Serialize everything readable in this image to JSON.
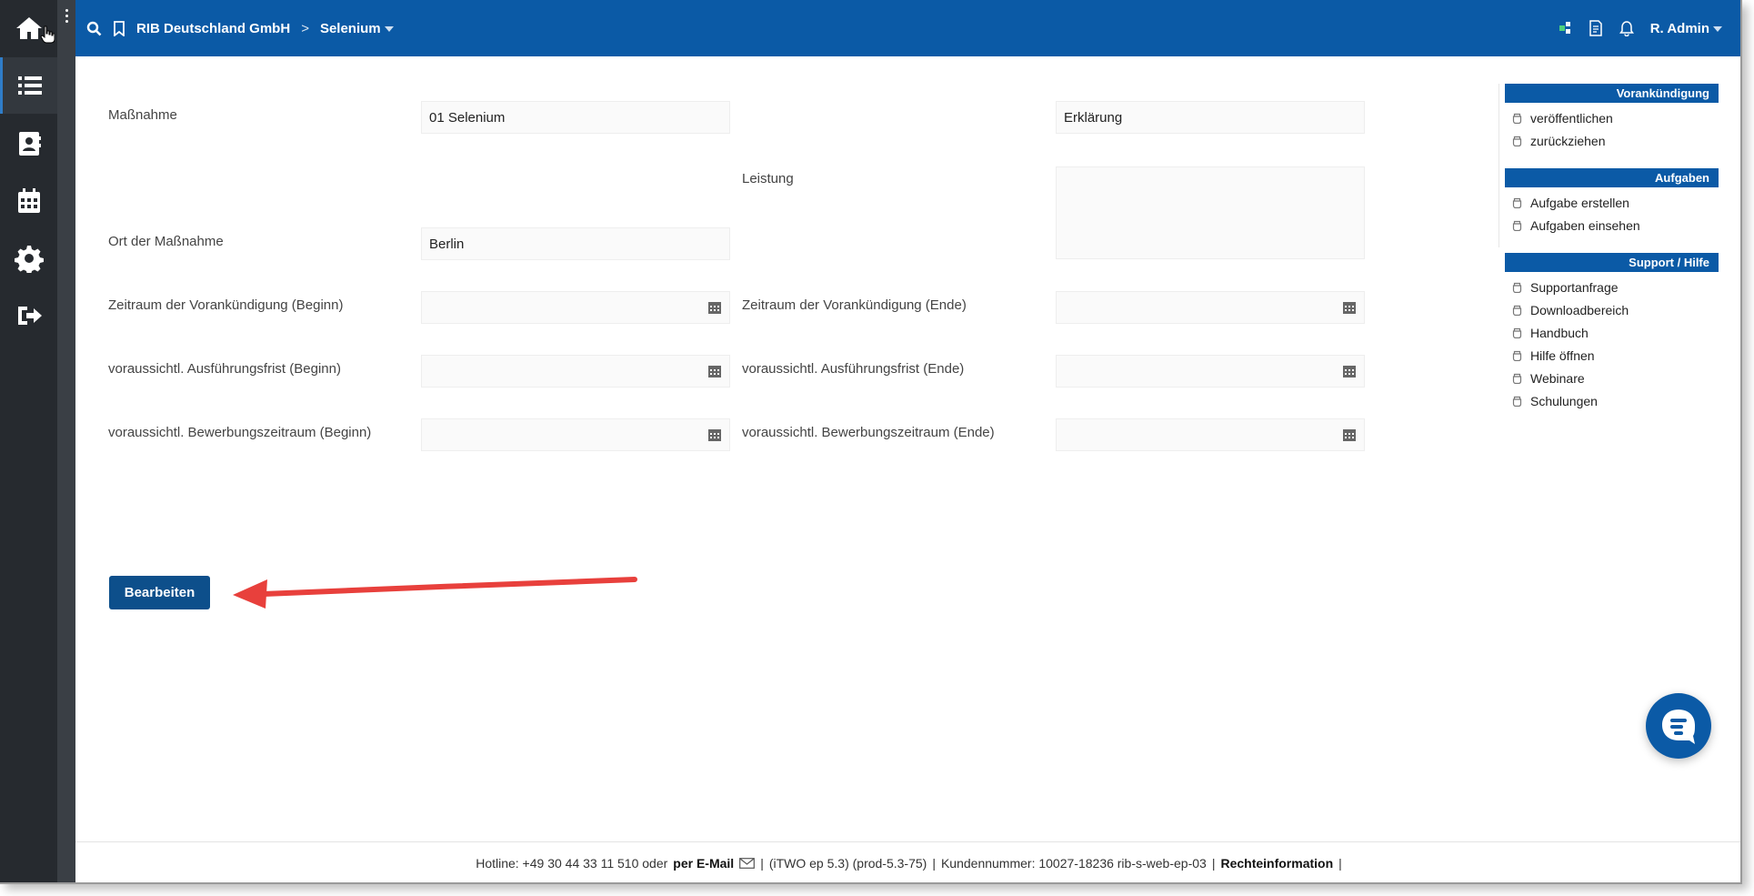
{
  "header": {
    "company": "RIB Deutschland GmbH",
    "separator": ">",
    "project": "Selenium",
    "user": "R. Admin"
  },
  "form": {
    "massnahme_label": "Maßnahme",
    "massnahme_value": "01 Selenium",
    "erklaerung_value": "Erklärung",
    "leistung_label": "Leistung",
    "leistung_value": "",
    "ort_label": "Ort der Maßnahme",
    "ort_value": "Berlin",
    "vorank_beginn_label": "Zeitraum der Vorankündigung (Beginn)",
    "vorank_ende_label": "Zeitraum der Vorankündigung (Ende)",
    "ausf_beginn_label": "voraussichtl. Ausführungsfrist (Beginn)",
    "ausf_ende_label": "voraussichtl. Ausführungsfrist (Ende)",
    "bew_beginn_label": "voraussichtl. Bewerbungszeitraum (Beginn)",
    "bew_ende_label": "voraussichtl. Bewerbungszeitraum (Ende)",
    "edit_button": "Bearbeiten"
  },
  "right_panel": {
    "sections": [
      {
        "title": "Vorankündigung",
        "items": [
          "veröffentlichen",
          "zurückziehen"
        ]
      },
      {
        "title": "Aufgaben",
        "items": [
          "Aufgabe erstellen",
          "Aufgaben einsehen"
        ]
      },
      {
        "title": "Support / Hilfe",
        "items": [
          "Supportanfrage",
          "Downloadbereich",
          "Handbuch",
          "Hilfe öffnen",
          "Webinare",
          "Schulungen"
        ]
      }
    ]
  },
  "footer": {
    "hotline": "Hotline: +49 30 44 33 11 510 oder",
    "email": "per E-Mail",
    "sep1": "|",
    "version": "(iTWO ep 5.3) (prod-5.3-75)",
    "sep2": "|",
    "customer": "Kundennummer: 10027-18236 rib-s-web-ep-03",
    "sep3": "|",
    "legal": "Rechteinformation",
    "sep4": "|"
  },
  "colors": {
    "brand_blue": "#0b5aa6",
    "button_blue": "#0d4f8b",
    "sidebar": "#262a2f",
    "annotation_arrow": "#e8403c"
  },
  "icons": {
    "sidebar": [
      "home-icon",
      "list-icon",
      "contacts-icon",
      "calendar-icon",
      "gear-icon",
      "logout-icon"
    ],
    "header_right": [
      "status-icon",
      "document-icon",
      "bell-icon"
    ]
  }
}
